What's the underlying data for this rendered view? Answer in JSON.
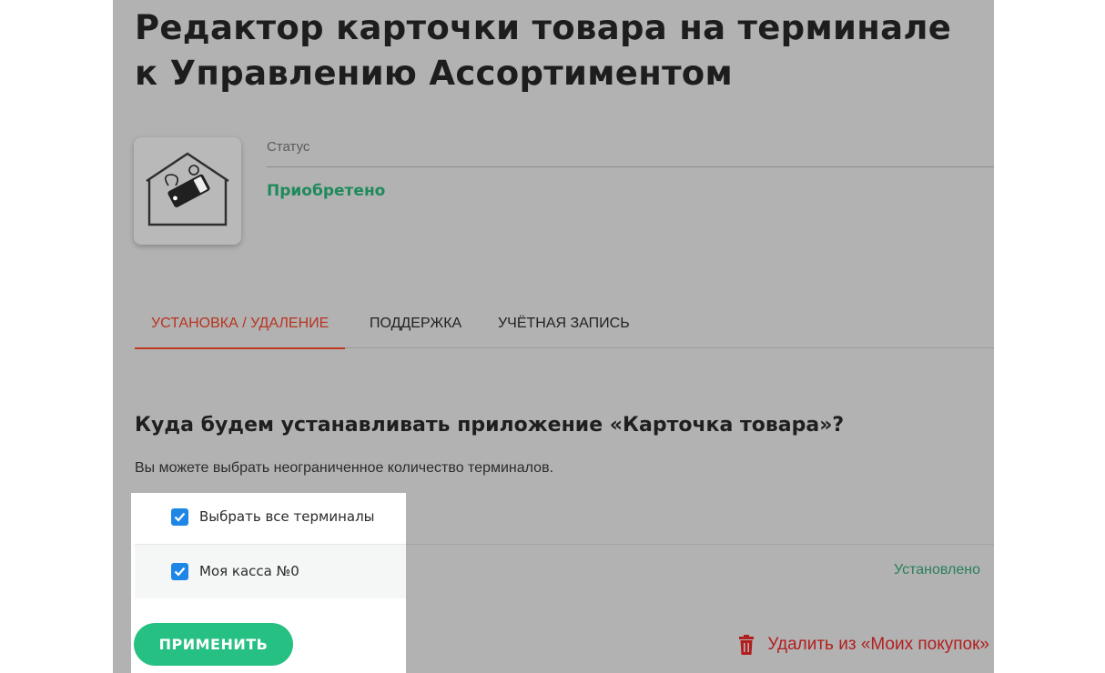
{
  "page": {
    "title": "Редактор карточки товара на терминале к Управлению Ассортиментом"
  },
  "app": {
    "icon": "house-price-tag-icon",
    "status_label": "Статус",
    "status_value": "Приобретено"
  },
  "tabs": [
    {
      "label": "Установка / Удаление",
      "active": true
    },
    {
      "label": "Поддержка",
      "active": false
    },
    {
      "label": "Учётная запись",
      "active": false
    }
  ],
  "install": {
    "heading": "Куда будем устанавливать приложение «Карточка товара»?",
    "hint": "Вы можете выбрать неограниченное количество терминалов.",
    "select_all_label": "Выбрать все терминалы",
    "terminals": [
      {
        "name": "Моя касса №0",
        "status": "Установлено",
        "checked": true
      }
    ],
    "apply_label": "ПРИМЕНИТЬ",
    "remove_label": "Удалить из «Моих покупок»"
  },
  "colors": {
    "accent_tab": "#c1391f",
    "status_green": "#1f8a5c",
    "apply_button": "#27c083",
    "danger": "#b21e1e",
    "checkbox": "#1e87e5"
  }
}
